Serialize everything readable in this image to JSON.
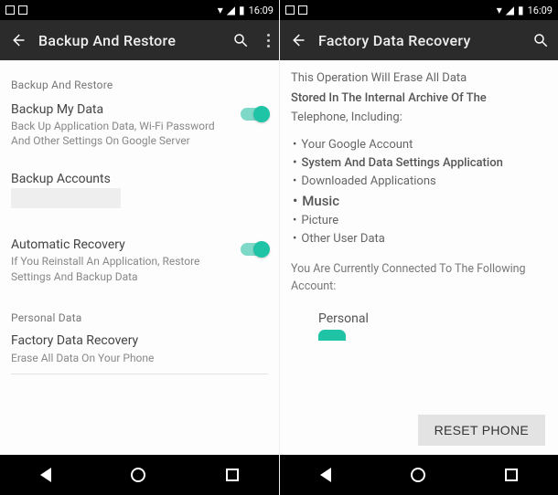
{
  "status": {
    "time": "16:09"
  },
  "left": {
    "appbar_title": "Backup And Restore",
    "section_header": "Backup And Restore",
    "backup_my_data": {
      "label": "Backup My Data",
      "sub": "Back Up Application Data, Wi-Fi Password And Other Settings On Google Server"
    },
    "backup_accounts": {
      "label": "Backup Accounts"
    },
    "auto_recovery": {
      "label": "Automatic Recovery",
      "sub": "If You Reinstall An Application, Restore Settings And Backup Data"
    },
    "personal_data_header": "Personal Data",
    "factory_recovery": {
      "label": "Factory Data Recovery",
      "sub": "Erase All Data On Your Phone"
    }
  },
  "right": {
    "appbar_title": "Factory Data Recovery",
    "warning_line1": "This Operation Will Erase All Data",
    "warning_line2": "Stored In The Internal Archive Of The",
    "warning_line3": "Telephone, Including:",
    "bullets": {
      "b1": "Your Google Account",
      "b2": "System And Data Settings Application",
      "b3": "Downloaded Applications",
      "b4": "Music",
      "b5": "Picture",
      "b6": "Other User Data"
    },
    "connected_label": "You Are Currently Connected To The Following Account:",
    "account_name": "Personal",
    "reset_button": "RESET PHONE"
  }
}
